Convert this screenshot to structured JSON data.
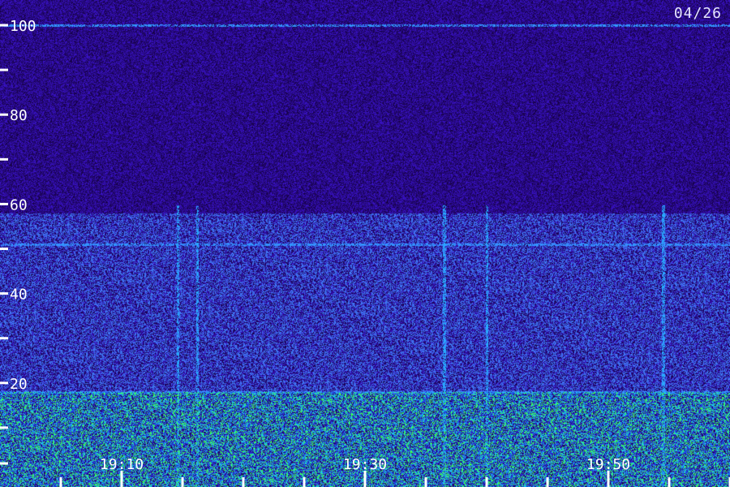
{
  "header": {
    "date": "04/26"
  },
  "chart_data": {
    "type": "heatmap",
    "title": "",
    "xlabel": "",
    "ylabel": "",
    "x_tick_labels": [
      "19:10",
      "19:30",
      "19:50"
    ],
    "x_tick_times_min": [
      10,
      30,
      50
    ],
    "x_range_min": [
      0,
      60
    ],
    "y_tick_labels": [
      "20",
      "40",
      "60",
      "80",
      "100"
    ],
    "y_tick_values": [
      20,
      40,
      60,
      80,
      100
    ],
    "y_range": [
      0,
      102
    ],
    "y_minor_tick_values": [
      10,
      30,
      50,
      70,
      90
    ],
    "x_minor_tick_times_min": [
      5,
      15,
      20,
      25,
      35,
      40,
      45,
      55,
      60
    ],
    "colormap": [
      "#05001a",
      "#2a10a8",
      "#3050ff",
      "#20c8ff",
      "#30ff60"
    ],
    "background_color": "#1a0a6e",
    "features": {
      "noise_floor_band": [
        0,
        18
      ],
      "emission_band": [
        18,
        58
      ],
      "horizontal_lines": [
        18,
        51,
        100
      ],
      "vertical_bursts_min": [
        14.6,
        16.2,
        36.5,
        40,
        54.5
      ]
    }
  }
}
